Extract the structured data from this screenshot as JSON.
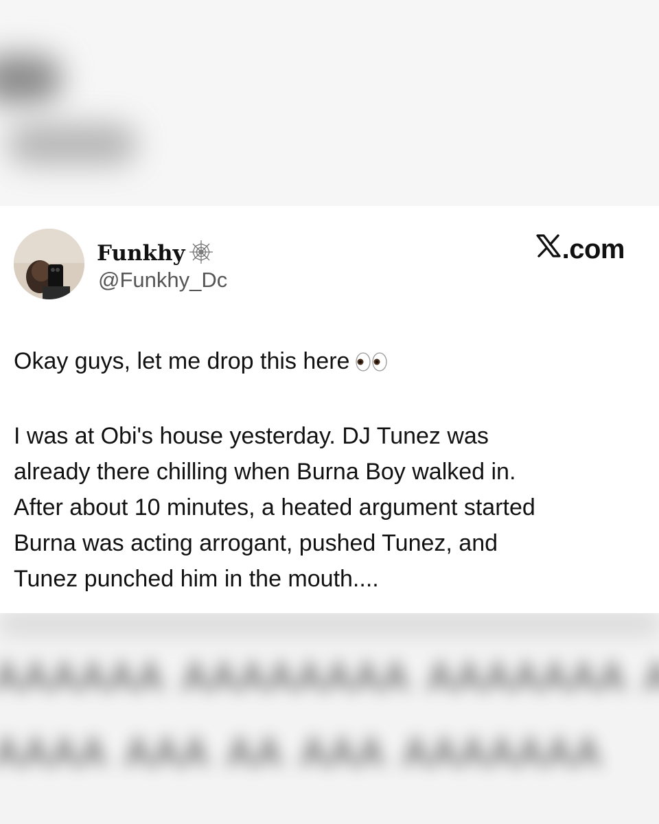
{
  "tweet": {
    "author": {
      "display_name": "Funkhy",
      "handle": "@Funkhy_Dc",
      "badge_icon": "spiderweb-icon"
    },
    "brand_label": ".com",
    "brand_icon": "x-logo-icon",
    "intro_line": "Okay guys, let me drop this here",
    "intro_emoji": "eyes-icon",
    "body_lines": [
      "I was at Obi's house yesterday. DJ Tunez was",
      "already there chilling when Burna Boy walked in.",
      "After about 10 minutes, a heated argument started",
      "Burna was acting arrogant, pushed Tunez, and",
      "Tunez punched him in the mouth...."
    ]
  },
  "colors": {
    "card_background": "#ffffff",
    "text_primary": "#111111",
    "text_secondary": "#555555"
  }
}
